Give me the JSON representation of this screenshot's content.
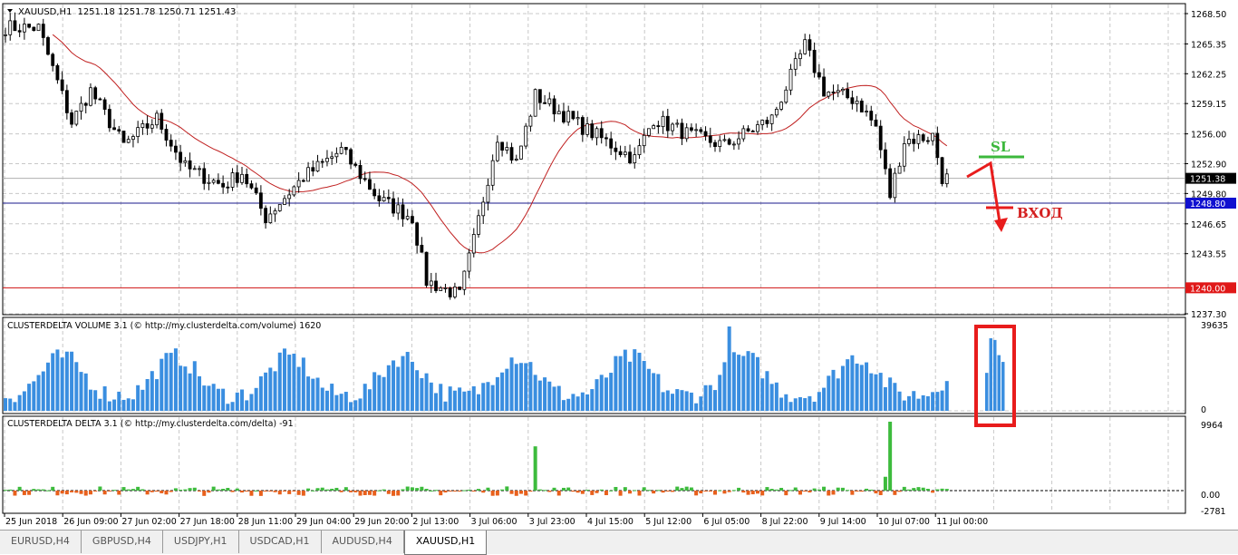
{
  "header": {
    "symbol": "XAUUSD,H1",
    "ohlc": "1251.18 1251.78 1250.71 1251.43"
  },
  "price_axis": {
    "ticks": [
      "1268.50",
      "1265.35",
      "1262.25",
      "1259.15",
      "1256.00",
      "1252.90",
      "1249.80",
      "1246.65",
      "1243.55",
      "1237.30"
    ],
    "current_price": "1251.38",
    "entry_line": "1248.80",
    "stop_line": "1240.00"
  },
  "annotations": {
    "sl_label": "SL",
    "entry_label": "ВХОД"
  },
  "volume_pane": {
    "title": "CLUSTERDELTA VOLUME 3.1 (© http://my.clusterdelta.com/volume) 1620",
    "max_label": "39635",
    "zero_label": "0"
  },
  "delta_pane": {
    "title": "CLUSTERDELTA DELTA 3.1 (© http://my.clusterdelta.com/delta) -91",
    "max_label": "9964",
    "zero_label": "0.00",
    "min_label": "-2781"
  },
  "time_axis": [
    "25 Jun 2018",
    "26 Jun 09:00",
    "27 Jun 02:00",
    "27 Jun 18:00",
    "28 Jun 11:00",
    "29 Jun 04:00",
    "29 Jun 20:00",
    "2 Jul 13:00",
    "3 Jul 06:00",
    "3 Jul 23:00",
    "4 Jul 15:00",
    "5 Jul 12:00",
    "6 Jul 05:00",
    "8 Jul 22:00",
    "9 Jul 14:00",
    "10 Jul 07:00",
    "11 Jul 00:00"
  ],
  "tabs": [
    {
      "label": "EURUSD,H4"
    },
    {
      "label": "GBPUSD,H4"
    },
    {
      "label": "USDJPY,H1"
    },
    {
      "label": "USDCAD,H1"
    },
    {
      "label": "AUDUSD,H4"
    },
    {
      "label": "XAUUSD,H1",
      "active": true
    }
  ],
  "colors": {
    "volume": "#3a8ee0",
    "delta_pos": "#3dbb3d",
    "delta_neg": "#e8601c",
    "ma": "#c02020",
    "entry": "#1a1a8c",
    "stop": "#d01010",
    "sl": "#3cb83c",
    "arrow": "#e81c1c"
  },
  "chart_data": {
    "type": "candlestick",
    "ylim": [
      1237.3,
      1268.5
    ],
    "close_path_anchors": [
      [
        0,
        1267.1
      ],
      [
        7,
        1267.0
      ],
      [
        14,
        1257.2
      ],
      [
        18,
        1260.5
      ],
      [
        25,
        1254.8
      ],
      [
        32,
        1257.6
      ],
      [
        38,
        1252.5
      ],
      [
        46,
        1250.6
      ],
      [
        50,
        1252.0
      ],
      [
        55,
        1247.3
      ],
      [
        63,
        1251.5
      ],
      [
        71,
        1254.3
      ],
      [
        79,
        1249.2
      ],
      [
        86,
        1247.3
      ],
      [
        89,
        1240.7
      ],
      [
        96,
        1239.2
      ],
      [
        99,
        1244.9
      ],
      [
        104,
        1255.8
      ],
      [
        108,
        1253.0
      ],
      [
        112,
        1260.0
      ],
      [
        122,
        1256.7
      ],
      [
        133,
        1253.4
      ],
      [
        137,
        1257.6
      ],
      [
        145,
        1255.8
      ],
      [
        152,
        1254.8
      ],
      [
        162,
        1257.6
      ],
      [
        169,
        1265.2
      ],
      [
        173,
        1260.5
      ],
      [
        180,
        1259.5
      ],
      [
        184,
        1256.7
      ],
      [
        187,
        1249.6
      ],
      [
        190,
        1255.3
      ],
      [
        196,
        1255.8
      ],
      [
        198,
        1251.5
      ],
      [
        199,
        1251.4
      ]
    ],
    "volume_max": 39635,
    "volume_forecast_boxed": [
      0.45,
      0.86,
      0.84,
      0.66,
      0.58
    ],
    "delta_range": [
      -2781,
      9964
    ],
    "delta_spikes": [
      [
        112,
        6400
      ],
      [
        187,
        9964
      ],
      [
        186,
        2000
      ]
    ]
  }
}
